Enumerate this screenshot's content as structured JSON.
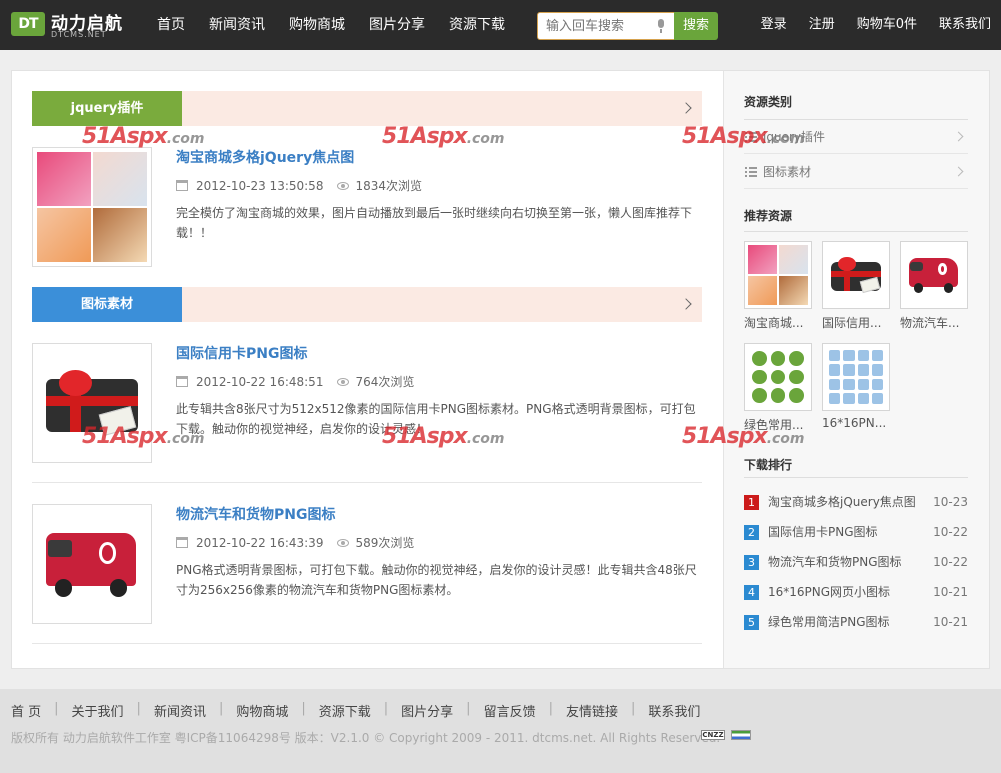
{
  "brand": {
    "logo_mark": "DT",
    "name": "动力启航",
    "sub": "DTCMS.NET"
  },
  "nav": [
    "首页",
    "新闻资讯",
    "购物商城",
    "图片分享",
    "资源下载"
  ],
  "search": {
    "placeholder": "输入回车搜索",
    "button": "搜索"
  },
  "user_nav": [
    "登录",
    "注册",
    "购物车0件",
    "联系我们"
  ],
  "watermark": {
    "text": "51Aspx",
    "suffix": ".com"
  },
  "sections": [
    {
      "category": "jquery插件",
      "tag_color": "#7aab3d",
      "items": [
        {
          "title": "淘宝商城多格jQuery焦点图",
          "date": "2012-10-23 13:50:58",
          "views": "1834次浏览",
          "desc": "完全模仿了淘宝商城的效果，图片自动播放到最后一张时继续向右切换至第一张，懒人图库推荐下载！！",
          "thumb": "taobao-slider-thumbnail"
        }
      ]
    },
    {
      "category": "图标素材",
      "tag_color": "#3b8fd9",
      "items": [
        {
          "title": "国际信用卡PNG图标",
          "date": "2012-10-22 16:48:51",
          "views": "764次浏览",
          "desc": "此专辑共含8张尺寸为512x512像素的国际信用卡PNG图标素材。PNG格式透明背景图标，可打包下载。触动你的视觉神经，启发你的设计灵感！",
          "thumb": "gift-card-thumbnail"
        },
        {
          "title": "物流汽车和货物PNG图标",
          "date": "2012-10-22 16:43:39",
          "views": "589次浏览",
          "desc": "PNG格式透明背景图标，可打包下载。触动你的视觉神经，启发你的设计灵感！此专辑共含48张尺寸为256x256像素的物流汽车和货物PNG图标素材。",
          "thumb": "delivery-van-thumbnail"
        }
      ]
    }
  ],
  "sidebar": {
    "categories_title": "资源类别",
    "categories": [
      "jquery插件",
      "图标素材"
    ],
    "recommended_title": "推荐资源",
    "recommended": [
      "淘宝商城...",
      "国际信用...",
      "物流汽车...",
      "绿色常用...",
      "16*16PN..."
    ],
    "ranking_title": "下载排行",
    "ranking": [
      {
        "num": "1",
        "title": "淘宝商城多格jQuery焦点图",
        "date": "10-23",
        "color": "#cc1b1b"
      },
      {
        "num": "2",
        "title": "国际信用卡PNG图标",
        "date": "10-22",
        "color": "#2b8ad1"
      },
      {
        "num": "3",
        "title": "物流汽车和货物PNG图标",
        "date": "10-22",
        "color": "#2b8ad1"
      },
      {
        "num": "4",
        "title": "16*16PNG网页小图标",
        "date": "10-21",
        "color": "#2b8ad1"
      },
      {
        "num": "5",
        "title": "绿色常用简洁PNG图标",
        "date": "10-21",
        "color": "#2b8ad1"
      }
    ]
  },
  "footer": {
    "links": [
      "首 页",
      "关于我们",
      "新闻资讯",
      "购物商城",
      "资源下载",
      "图片分享",
      "留言反馈",
      "友情链接",
      "联系我们"
    ],
    "copyright": "版权所有 动力启航软件工作室 粤ICP备11064298号 版本：V2.1.0 © Copyright 2009 - 2011. dtcms.net. All Rights Reserved.",
    "badge": "CNZZ"
  }
}
